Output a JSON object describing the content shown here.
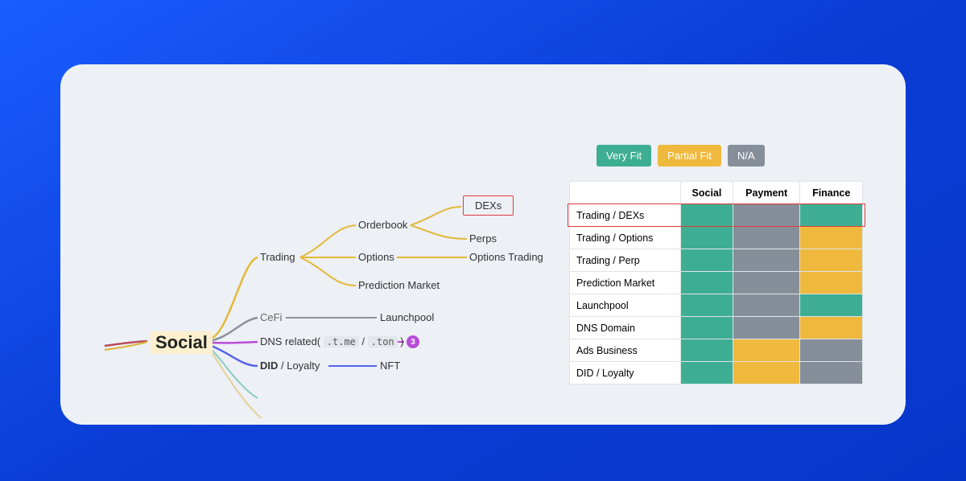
{
  "root": "Social",
  "nodes": {
    "trading": "Trading",
    "cefi": "CeFi",
    "dns_prefix": "DNS related(",
    "dns_tag1": ".t.me",
    "dns_sep": " / ",
    "dns_tag2": ".ton",
    "dns_suffix": ")",
    "did_bold": "DID",
    "did_rest": " / Loyalty",
    "orderbook": "Orderbook",
    "options": "Options",
    "predmkt": "Prediction Market",
    "launchpool": "Launchpool",
    "nft": "NFT",
    "dexs": "DEXs",
    "perps": "Perps",
    "opttrade": "Options Trading",
    "badge": "3"
  },
  "legend": {
    "very": "Very Fit",
    "partial": "Partial Fit",
    "na": "N/A"
  },
  "table": {
    "headers": [
      "",
      "Social",
      "Payment",
      "Finance"
    ],
    "rows": [
      {
        "label": "Trading / DEXs",
        "cells": [
          "v",
          "n",
          "v"
        ]
      },
      {
        "label": "Trading / Options",
        "cells": [
          "v",
          "n",
          "p"
        ]
      },
      {
        "label": "Trading / Perp",
        "cells": [
          "v",
          "n",
          "p"
        ]
      },
      {
        "label": "Prediction Market",
        "cells": [
          "v",
          "n",
          "p"
        ]
      },
      {
        "label": "Launchpool",
        "cells": [
          "v",
          "n",
          "v"
        ]
      },
      {
        "label": "DNS Domain",
        "cells": [
          "v",
          "n",
          "p"
        ]
      },
      {
        "label": "Ads Business",
        "cells": [
          "v",
          "p",
          "n"
        ]
      },
      {
        "label": "DID / Loyalty",
        "cells": [
          "v",
          "p",
          "n"
        ]
      }
    ]
  }
}
